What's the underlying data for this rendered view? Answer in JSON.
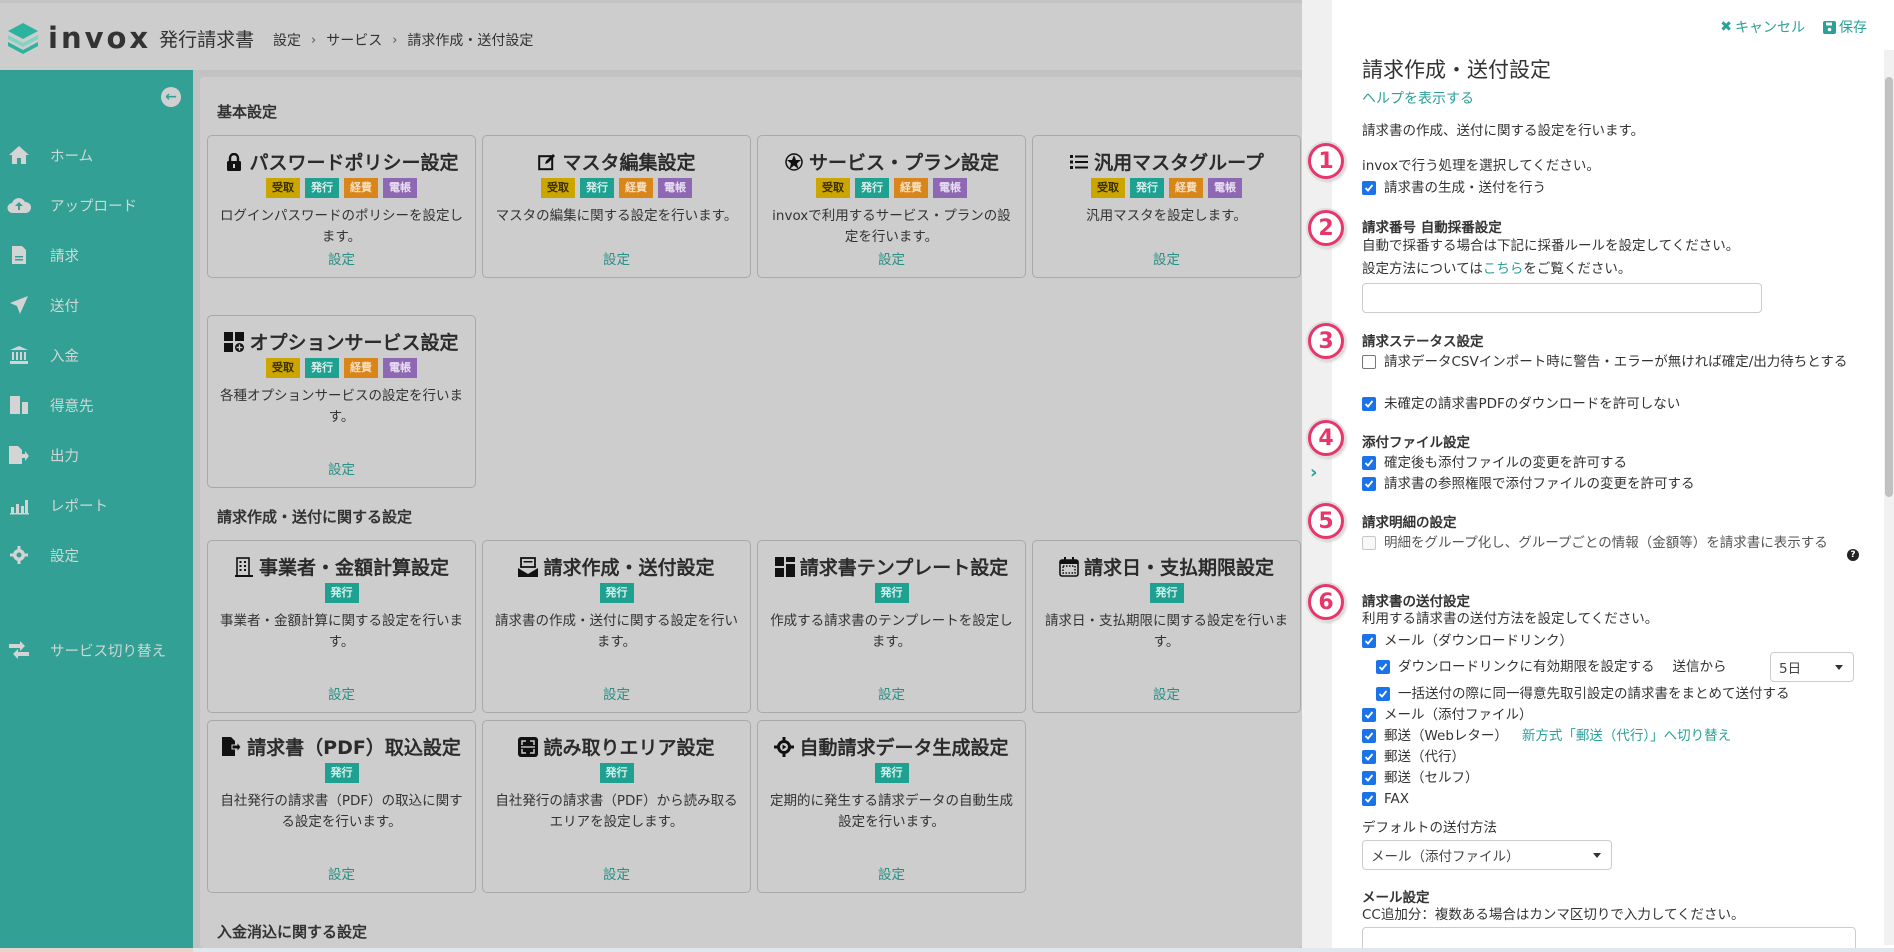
{
  "app": {
    "logo_text": "invox",
    "logo_sub": "発行請求書"
  },
  "breadcrumb": [
    "設定",
    "サービス",
    "請求作成・送付設定"
  ],
  "sidebar": {
    "items": [
      {
        "label": "ホーム",
        "icon": "home-icon"
      },
      {
        "label": "アップロード",
        "icon": "cloud-upload-icon"
      },
      {
        "label": "請求",
        "icon": "document-icon"
      },
      {
        "label": "送付",
        "icon": "paper-plane-icon"
      },
      {
        "label": "入金",
        "icon": "bank-icon"
      },
      {
        "label": "得意先",
        "icon": "building-icon"
      },
      {
        "label": "出力",
        "icon": "file-export-icon"
      },
      {
        "label": "レポート",
        "icon": "chart-icon"
      },
      {
        "label": "設定",
        "icon": "gear-icon"
      }
    ],
    "switch_label": "サービス切り替え"
  },
  "badges": {
    "recv": "受取",
    "issue": "発行",
    "exp": "経費",
    "ledger": "電帳"
  },
  "sections": [
    {
      "title": "基本設定",
      "cards": [
        {
          "title": "パスワードポリシー設定",
          "icon": "lock-icon",
          "desc": "ログインパスワードのポリシーを設定します。",
          "link": "設定"
        },
        {
          "title": "マスタ編集設定",
          "icon": "edit-icon",
          "desc": "マスタの編集に関する設定を行います。",
          "link": "設定"
        },
        {
          "title": "サービス・プラン設定",
          "icon": "star-badge-icon",
          "desc": "invoxで利用するサービス・プランの設定を行います。",
          "link": "設定"
        },
        {
          "title": "汎用マスタグループ",
          "icon": "list-icon",
          "desc": "汎用マスタを設定します。",
          "link": "設定"
        },
        {
          "title": "オプションサービス設定",
          "icon": "grid-plus-icon",
          "desc": "各種オプションサービスの設定を行います。",
          "link": "設定"
        }
      ]
    },
    {
      "title": "請求作成・送付に関する設定",
      "cards": [
        {
          "title": "事業者・金額計算設定",
          "icon": "office-building-icon",
          "desc": "事業者・金額計算に関する設定を行います。",
          "link": "設定"
        },
        {
          "title": "請求作成・送付設定",
          "icon": "mail-send-icon",
          "desc": "請求書の作成・送付に関する設定を行います。",
          "link": "設定"
        },
        {
          "title": "請求書テンプレート設定",
          "icon": "template-icon",
          "desc": "作成する請求書のテンプレートを設定します。",
          "link": "設定"
        },
        {
          "title": "請求日・支払期限設定",
          "icon": "calendar-icon",
          "desc": "請求日・支払期限に関する設定を行います。",
          "link": "設定"
        },
        {
          "title": "請求書（PDF）取込設定",
          "icon": "file-import-icon",
          "desc": "自社発行の請求書（PDF）の取込に関する設定を行います。",
          "link": "設定"
        },
        {
          "title": "読み取りエリア設定",
          "icon": "scan-area-icon",
          "desc": "自社発行の請求書（PDF）から読み取るエリアを設定します。",
          "link": "設定"
        },
        {
          "title": "自動請求データ生成設定",
          "icon": "gear-play-icon",
          "desc": "定期的に発生する請求データの自動生成設定を行います。",
          "link": "設定"
        }
      ]
    },
    {
      "title": "入金消込に関する設定",
      "cards": []
    }
  ],
  "drawer": {
    "cancel_label": "キャンセル",
    "save_label": "保存",
    "title": "請求作成・送付設定",
    "help_link": "ヘルプを表示する",
    "intro": "請求書の作成、送付に関する設定を行います。",
    "s1": {
      "num": "1",
      "text": "invoxで行う処理を選択してください。",
      "checkbox": {
        "label": "請求書の生成・送付を行う",
        "checked": true
      }
    },
    "s2": {
      "num": "2",
      "heading": "請求番号 自動採番設定",
      "text": "自動で採番する場合は下記に採番ルールを設定してください。",
      "text2_pre": "設定方法については",
      "text2_link": "こちら",
      "text2_post": "をご覧ください。",
      "input_value": ""
    },
    "s3": {
      "num": "3",
      "heading": "請求ステータス設定",
      "checkboxes": [
        {
          "label": "請求データCSVインポート時に警告・エラーが無ければ確定/出力待ちとする",
          "checked": false
        },
        {
          "label": "未確定の請求書PDFのダウンロードを許可しない",
          "checked": true
        }
      ]
    },
    "s4": {
      "num": "4",
      "heading": "添付ファイル設定",
      "checkboxes": [
        {
          "label": "確定後も添付ファイルの変更を許可する",
          "checked": true
        },
        {
          "label": "請求書の参照権限で添付ファイルの変更を許可する",
          "checked": true
        }
      ]
    },
    "s5": {
      "num": "5",
      "heading": "請求明細の設定",
      "checkbox": {
        "label": "明細をグループ化し、グループごとの情報（金額等）を請求書に表示する",
        "checked": false,
        "disabled": true
      }
    },
    "s6": {
      "num": "6",
      "heading": "請求書の送付設定",
      "text": "利用する請求書の送付方法を設定してください。",
      "methods": [
        {
          "label": "メール（ダウンロードリンク）",
          "checked": true
        },
        {
          "label": "ダウンロードリンクに有効期限を設定する",
          "checked": true
        },
        {
          "label": "一括送付の際に同一得意先取引設定の請求書をまとめて送付する",
          "checked": true
        },
        {
          "label": "メール（添付ファイル）",
          "checked": true
        },
        {
          "label": "郵送（Webレター）",
          "checked": true
        },
        {
          "label": "郵送（代行）",
          "checked": true
        },
        {
          "label": "郵送（セルフ）",
          "checked": true
        },
        {
          "label": "FAX",
          "checked": true
        }
      ],
      "expiry_prefix": "送信から",
      "expiry_value": "5日",
      "webletter_link": "新方式「郵送（代行）」へ切り替え",
      "default_label": "デフォルトの送付方法",
      "default_value": "メール（添付ファイル）"
    },
    "mail": {
      "heading": "メール設定",
      "cc_text": "CC追加分：複数ある場合はカンマ区切りで入力してください。",
      "cc_value": ""
    }
  },
  "colors": {
    "accent": "#2aa198",
    "sidebar": "#33a095",
    "checkbox": "#1a73e8",
    "number_badge": "#e8356a"
  }
}
